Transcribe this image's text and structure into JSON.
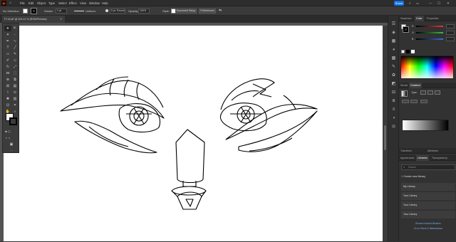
{
  "app": {
    "logo": "Ai",
    "share_label": "Share"
  },
  "menu": [
    "File",
    "Edit",
    "Object",
    "Type",
    "Select",
    "Effect",
    "View",
    "Window",
    "Help"
  ],
  "control_bar": {
    "selection": "No Selection",
    "stroke_label": "Stroke:",
    "stroke_value": "1 pt",
    "uniform_label": "Uniform",
    "brush_label": "5 pt. Round",
    "opacity_label": "Opacity:",
    "opacity_value": "100%",
    "style_label": "Style:",
    "document_setup": "Document Setup",
    "preferences": "Preferences"
  },
  "document_tab": {
    "title": "F7.AI.ai* @ 204.21 % (RGB/Preview)"
  },
  "right_panel": {
    "top_tabs": [
      "Swatches",
      "Color",
      "Properties"
    ],
    "sliders": [
      {
        "label": "R",
        "value": "",
        "color": "#e03b3b"
      },
      {
        "label": "G",
        "value": "",
        "color": "#3bbd4a"
      },
      {
        "label": "B",
        "value": "",
        "color": "#3b6de0"
      }
    ],
    "mid_tabs": [
      "Stroke",
      "Gradient"
    ],
    "gradient": {
      "type_label": "Type:"
    },
    "lib_tabs": [
      "Appearance",
      "Libraries",
      "Transparency"
    ],
    "transform_tabs": [
      "Transform",
      "Attributes"
    ],
    "search_placeholder": "Search",
    "create_library": "Create new library",
    "libraries": [
      "My Library",
      "Your Library",
      "Your Library",
      "Your Library"
    ],
    "shared_link": "Browse shared libraries",
    "stock_link": "Go to Stock & Marketplace"
  },
  "colors": {
    "accent": "#1473e6",
    "canvas": "#ffffff",
    "workspace": "#535353"
  }
}
